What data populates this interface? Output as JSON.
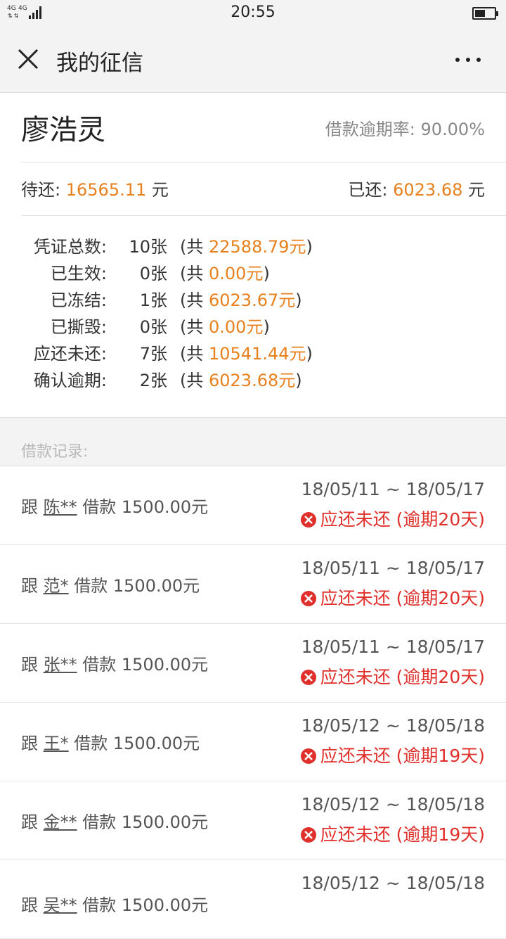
{
  "status_bar": {
    "network_a": "4G",
    "network_b": "4G",
    "time": "20:55"
  },
  "header": {
    "title": "我的征信"
  },
  "profile": {
    "name": "廖浩灵",
    "overdue_rate_label": "借款逾期率:",
    "overdue_rate_value": "90.00%"
  },
  "payments": {
    "pending_label": "待还:",
    "pending_value": "16565.11",
    "pending_unit": "元",
    "repaid_label": "已还:",
    "repaid_value": "6023.68",
    "repaid_unit": "元"
  },
  "stats": [
    {
      "label": "凭证总数:",
      "count": "10张",
      "prefix": "(共 ",
      "amount": "22588.79元",
      "suffix": ")"
    },
    {
      "label": "已生效:",
      "count": "0张",
      "prefix": "(共 ",
      "amount": "0.00元",
      "suffix": ")"
    },
    {
      "label": "已冻结:",
      "count": "1张",
      "prefix": "(共 ",
      "amount": "6023.67元",
      "suffix": ")"
    },
    {
      "label": "已撕毁:",
      "count": "0张",
      "prefix": "(共 ",
      "amount": "0.00元",
      "suffix": ")"
    },
    {
      "label": "应还未还:",
      "count": "7张",
      "prefix": "(共 ",
      "amount": "10541.44元",
      "suffix": ")"
    },
    {
      "label": "确认逾期:",
      "count": "2张",
      "prefix": "(共 ",
      "amount": "6023.68元",
      "suffix": ")"
    }
  ],
  "records_title": "借款记录:",
  "records": [
    {
      "prefix": "跟 ",
      "lender": "陈**",
      "text": " 借款 1500.00元",
      "date": "18/05/11 ~ 18/05/17",
      "status": "应还未还 (逾期20天)"
    },
    {
      "prefix": "跟 ",
      "lender": "范*",
      "text": " 借款 1500.00元",
      "date": "18/05/11 ~ 18/05/17",
      "status": "应还未还 (逾期20天)"
    },
    {
      "prefix": "跟 ",
      "lender": "张**",
      "text": " 借款 1500.00元",
      "date": "18/05/11 ~ 18/05/17",
      "status": "应还未还 (逾期20天)"
    },
    {
      "prefix": "跟 ",
      "lender": "王*",
      "text": " 借款 1500.00元",
      "date": "18/05/12 ~ 18/05/18",
      "status": "应还未还 (逾期19天)"
    },
    {
      "prefix": "跟 ",
      "lender": "金**",
      "text": " 借款 1500.00元",
      "date": "18/05/12 ~ 18/05/18",
      "status": "应还未还 (逾期19天)"
    },
    {
      "prefix": "跟 ",
      "lender": "吴**",
      "text": " 借款 1500.00元",
      "date": "18/05/12 ~ 18/05/18",
      "status": ""
    }
  ],
  "colors": {
    "amount": "#e8801e",
    "overdue": "#e0302c"
  }
}
